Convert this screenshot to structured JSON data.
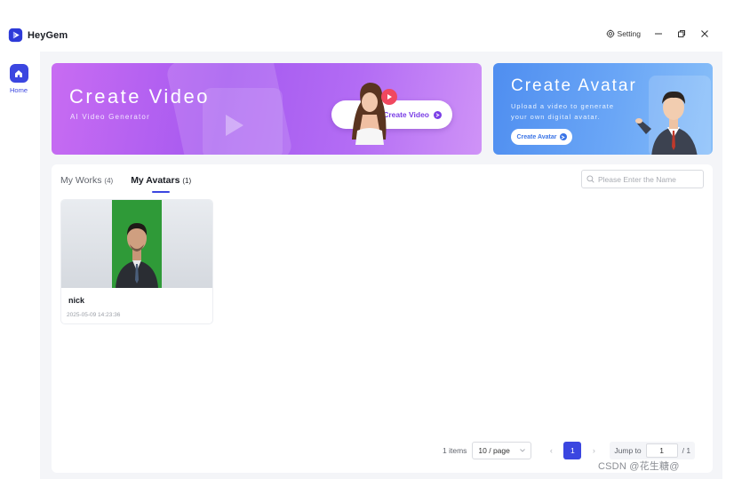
{
  "app": {
    "name": "HeyGem",
    "setting_label": "Setting",
    "colors": {
      "accent": "#3b46e0",
      "video_banner": "#a559f0",
      "avatar_banner": "#4f8ef0"
    }
  },
  "sidebar": {
    "items": [
      {
        "label": "Home",
        "icon": "home-icon",
        "active": true
      }
    ]
  },
  "banners": {
    "video": {
      "title": "Create Video",
      "subtitle": "AI Video Generator",
      "button_label": "Create Video"
    },
    "avatar": {
      "title": "Create Avatar",
      "subtitle_line1": "Upload a video to generate",
      "subtitle_line2": "your own digital avatar.",
      "button_label": "Create Avatar"
    }
  },
  "tabs": [
    {
      "label": "My Works",
      "count": "(4)",
      "active": false
    },
    {
      "label": "My Avatars",
      "count": "(1)",
      "active": true
    }
  ],
  "search": {
    "placeholder": "Please Enter the Name",
    "value": ""
  },
  "avatars": [
    {
      "name": "nick",
      "date": "2025-05-09 14:23:36"
    }
  ],
  "pagination": {
    "total_label": "1 items",
    "page_size": "10 / page",
    "current_page": "1",
    "prev_symbol": "‹",
    "next_symbol": "›",
    "jump_label": "Jump to",
    "jump_value": "1",
    "total_pages": "/ 1"
  },
  "watermark": "CSDN @花生糖@"
}
